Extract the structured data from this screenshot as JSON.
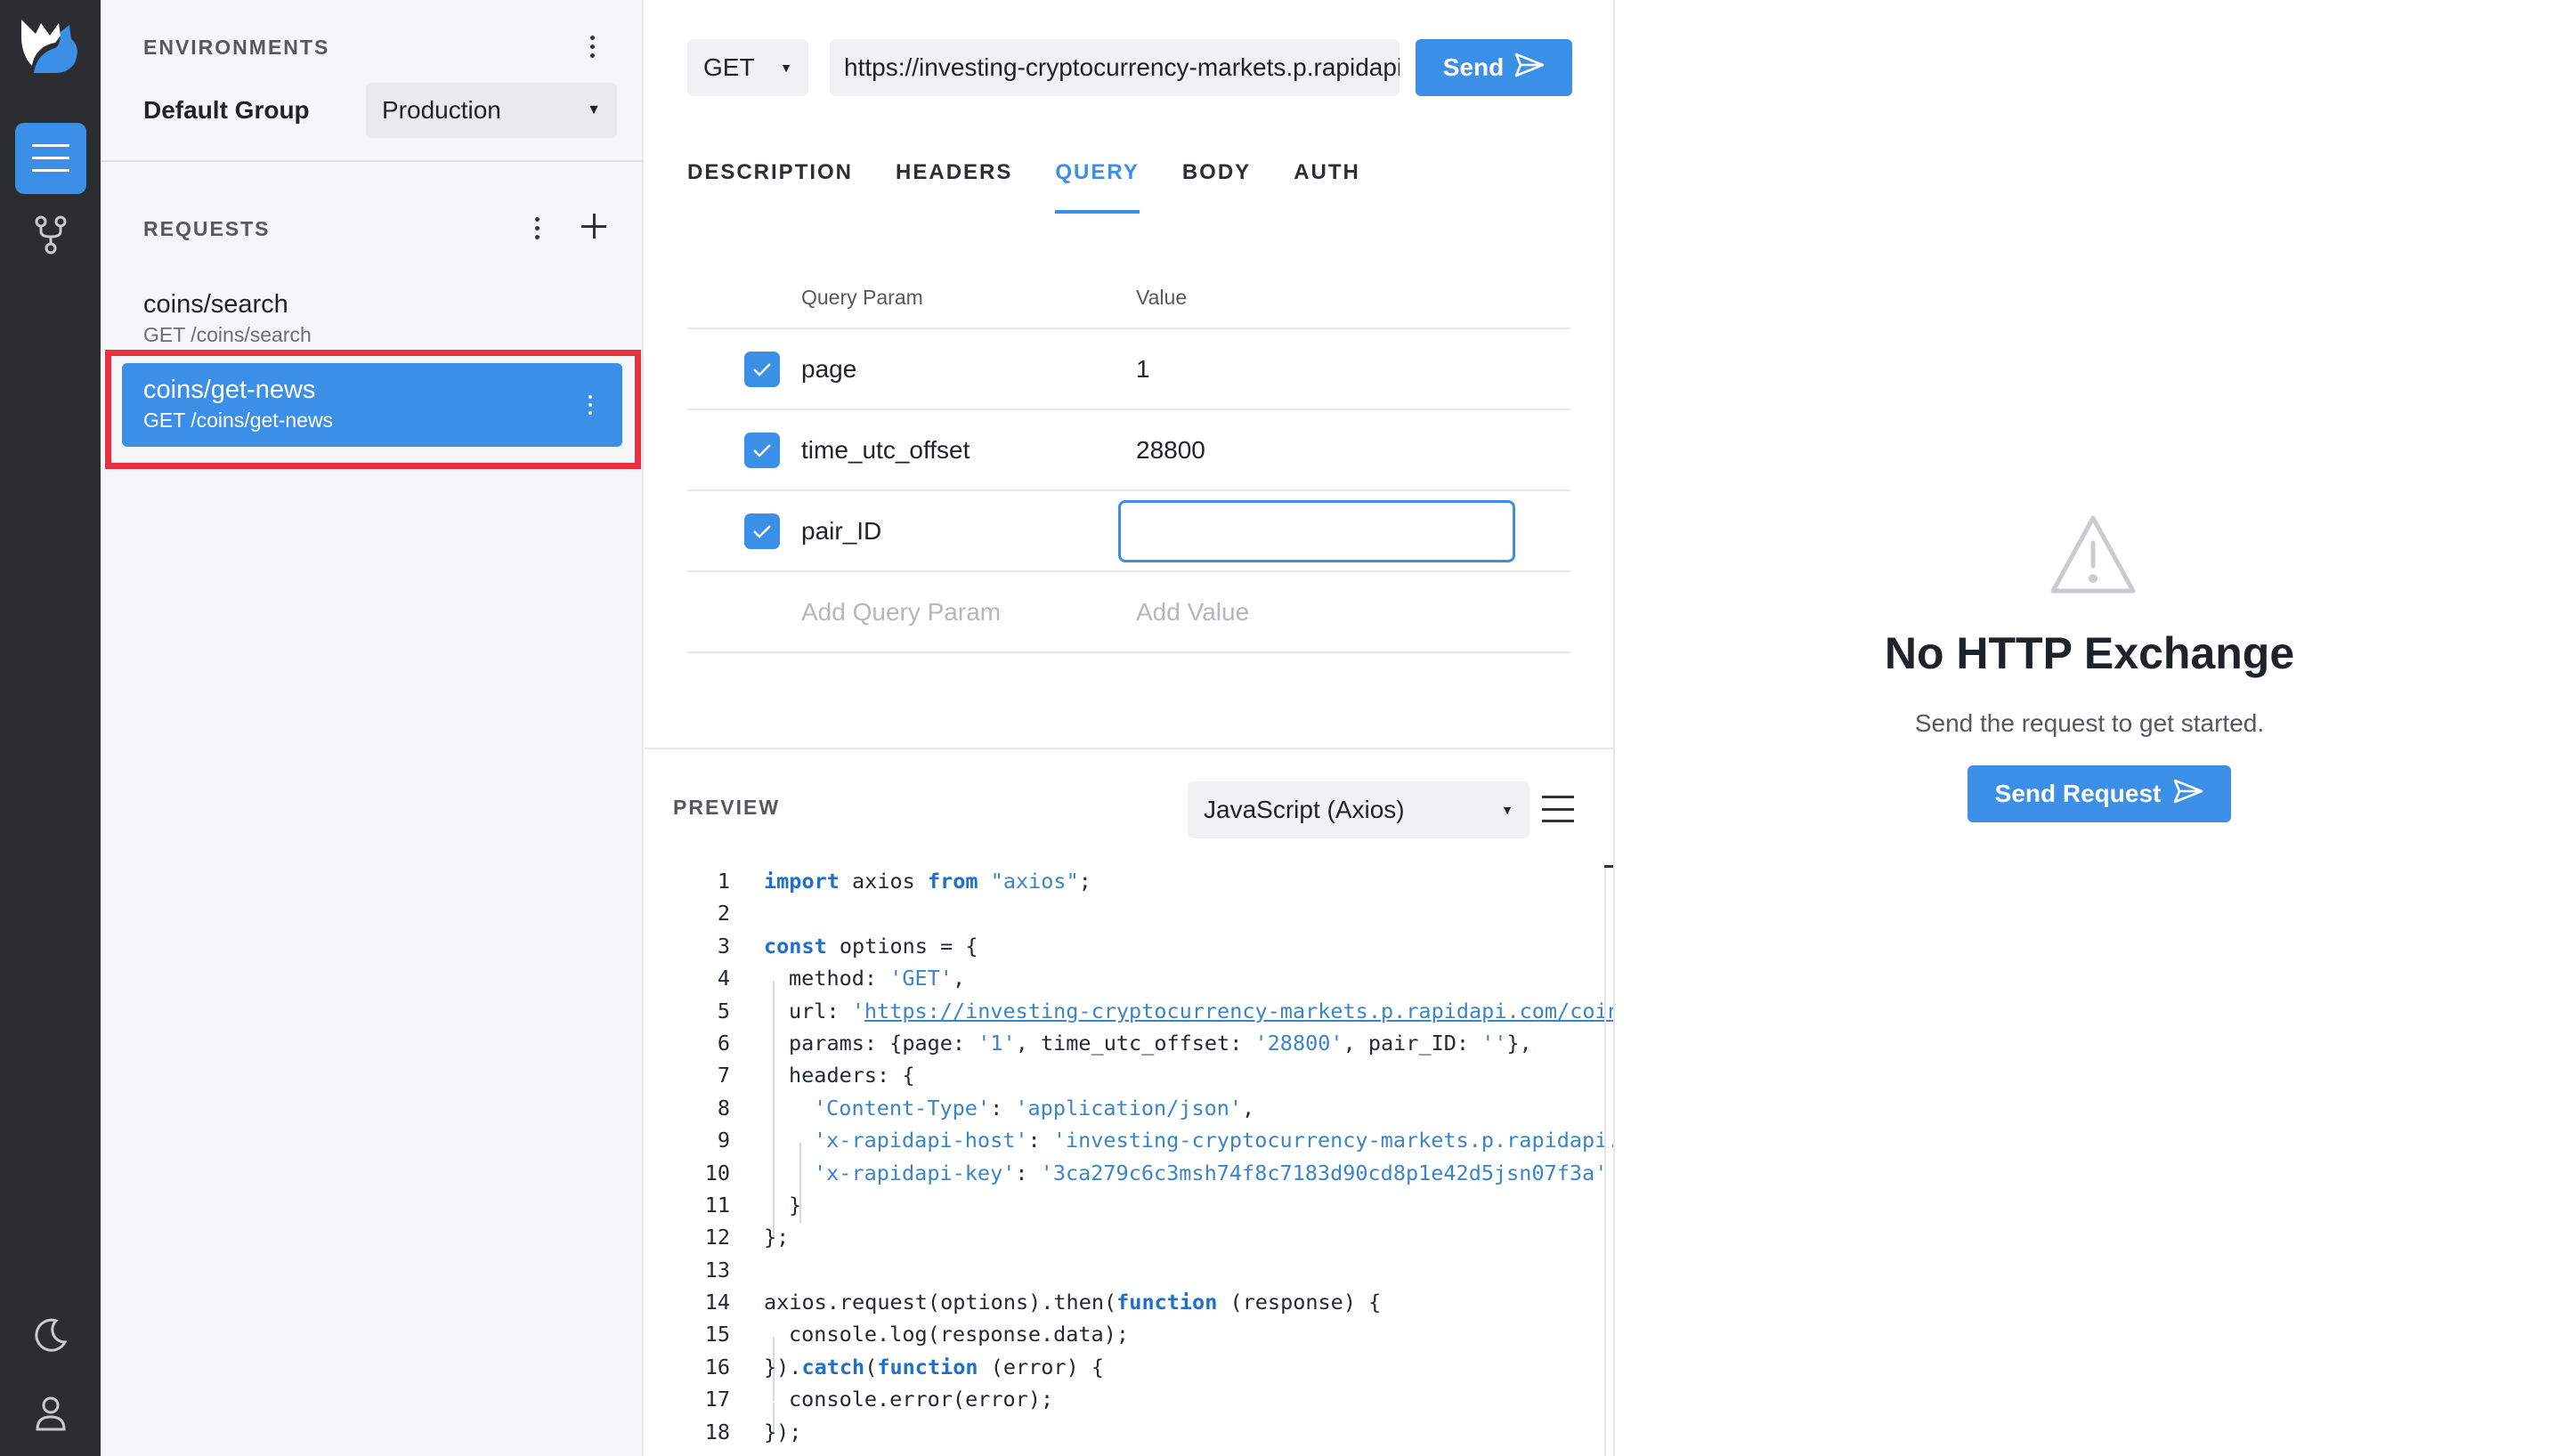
{
  "rail": {
    "icons": [
      "logo-icon",
      "requests-icon",
      "branch-icon",
      "moon-icon",
      "user-icon"
    ]
  },
  "environments": {
    "title": "ENVIRONMENTS",
    "group_label": "Default Group",
    "selected": "Production"
  },
  "requests": {
    "title": "REQUESTS",
    "items": [
      {
        "name": "coins/search",
        "path": "GET /coins/search",
        "selected": false
      },
      {
        "name": "coins/get-news",
        "path": "GET /coins/get-news",
        "selected": true
      }
    ]
  },
  "request_bar": {
    "method": "GET",
    "url": "https://investing-cryptocurrency-markets.p.rapidapi.com/coins/get-news",
    "send_label": "Send"
  },
  "tabs": [
    {
      "label": "DESCRIPTION",
      "active": false
    },
    {
      "label": "HEADERS",
      "active": false
    },
    {
      "label": "QUERY",
      "active": true
    },
    {
      "label": "BODY",
      "active": false
    },
    {
      "label": "AUTH",
      "active": false
    }
  ],
  "query": {
    "col_param": "Query Param",
    "col_value": "Value",
    "rows": [
      {
        "key": "page",
        "value": "1",
        "checked": true
      },
      {
        "key": "time_utc_offset",
        "value": "28800",
        "checked": true
      },
      {
        "key": "pair_ID",
        "value": "",
        "checked": true
      }
    ],
    "add_param_placeholder": "Add Query Param",
    "add_value_placeholder": "Add Value"
  },
  "preview": {
    "title": "PREVIEW",
    "language": "JavaScript (Axios)"
  },
  "code": {
    "l1": {
      "n": "1",
      "kw1": "import",
      "t1": " axios ",
      "kw2": "from",
      "t2": " ",
      "s1": "\"axios\"",
      "t3": ";"
    },
    "l2": {
      "n": "2"
    },
    "l3": {
      "n": "3",
      "kw1": "const",
      "t1": " options = {"
    },
    "l4": {
      "n": "4",
      "t1": "method: ",
      "s1": "'GET'",
      "t2": ","
    },
    "l5": {
      "n": "5",
      "t1": "url: ",
      "s1": "'",
      "u1": "https://investing-cryptocurrency-markets.p.rapidapi.com/coins/get-news"
    },
    "l6": {
      "n": "6",
      "t1": "params: {page: ",
      "s1": "'1'",
      "t2": ", time_utc_offset: ",
      "s2": "'28800'",
      "t3": ", pair_ID: ",
      "s3": "''",
      "t4": "},"
    },
    "l7": {
      "n": "7",
      "t1": "headers: {"
    },
    "l8": {
      "n": "8",
      "s1": "'Content-Type'",
      "t1": ": ",
      "s2": "'application/json'",
      "t2": ","
    },
    "l9": {
      "n": "9",
      "s1": "'x-rapidapi-host'",
      "t1": ": ",
      "s2": "'investing-cryptocurrency-markets.p.rapidapi.com'"
    },
    "l10": {
      "n": "10",
      "s1": "'x-rapidapi-key'",
      "t1": ": ",
      "s2": "'3ca279c6c3msh74f8c7183d90cd8p1e42d5jsn07f3a'"
    },
    "l11": {
      "n": "11",
      "t1": "}"
    },
    "l12": {
      "n": "12",
      "t1": "};"
    },
    "l13": {
      "n": "13"
    },
    "l14": {
      "n": "14",
      "t1": "axios.request(options).then(",
      "kw1": "function",
      "t2": " (response) {"
    },
    "l15": {
      "n": "15",
      "t1": "console.log(response.data);"
    },
    "l16": {
      "n": "16",
      "t1": "}).",
      "kw1": "catch",
      "t2": "(",
      "kw2": "function",
      "t3": " (error) {"
    },
    "l17": {
      "n": "17",
      "t1": "console.error(error);"
    },
    "l18": {
      "n": "18",
      "t1": "});"
    }
  },
  "response": {
    "empty_title": "No HTTP Exchange",
    "empty_subtitle": "Send the request to get started.",
    "send_request_label": "Send Request"
  },
  "colors": {
    "accent": "#3b8fe6",
    "rail_bg": "#2c2d30",
    "highlight": "#e8303f"
  }
}
